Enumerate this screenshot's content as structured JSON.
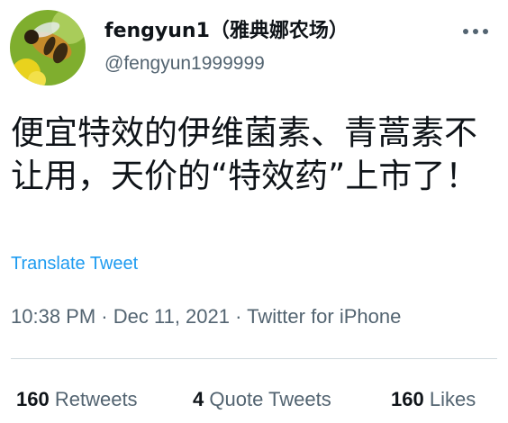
{
  "author": {
    "display_name": "fengyun1（雅典娜农场）",
    "handle": "@fengyun1999999",
    "avatar_icon": "bee-on-flower-avatar"
  },
  "tweet": {
    "text": "便宜特效的伊维菌素、青蒿素不让用，天价的“特效药”上市了！"
  },
  "translate_label": "Translate Tweet",
  "meta": {
    "time": "10:38 PM",
    "date": "Dec 11, 2021",
    "source": "Twitter for iPhone",
    "separator": "·"
  },
  "stats": {
    "retweets": {
      "count": "160",
      "label": "Retweets"
    },
    "quote_tweets": {
      "count": "4",
      "label": "Quote Tweets"
    },
    "likes": {
      "count": "160",
      "label": "Likes"
    }
  },
  "colors": {
    "link": "#1d9bf0",
    "secondary_text": "#536471",
    "primary_text": "#0f1419",
    "divider": "#cfd9de"
  }
}
